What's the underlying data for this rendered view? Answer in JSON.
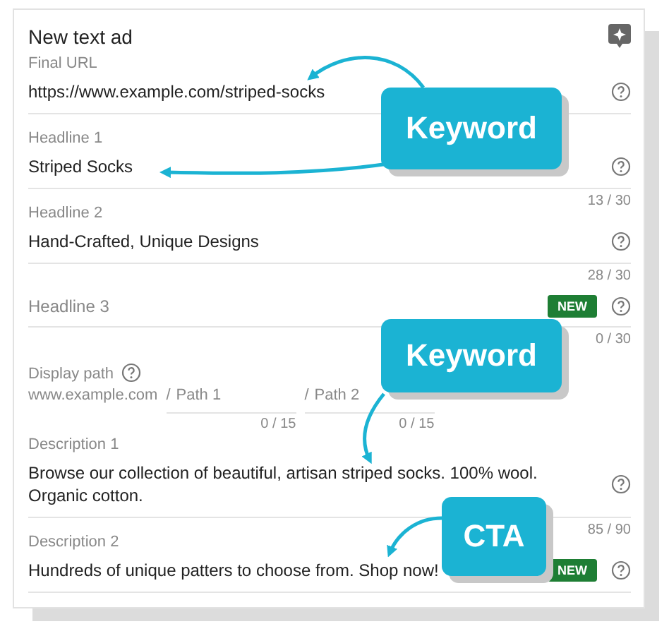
{
  "title": "New text ad",
  "fields": [
    {
      "kind": "text",
      "label": "Final URL",
      "value": "https://www.example.com/striped-socks",
      "help": true
    },
    {
      "kind": "text",
      "label": "Headline 1",
      "value": "Striped Socks",
      "help": true,
      "counter": "13 / 30"
    },
    {
      "kind": "text",
      "label": "Headline 2",
      "value": "Hand-Crafted, Unique Designs",
      "help": true,
      "counter": "28 / 30"
    },
    {
      "kind": "empty",
      "label": "Headline 3",
      "help": true,
      "badge": "NEW",
      "counter": "0 / 30"
    },
    {
      "kind": "path",
      "label": "Display path",
      "help": true,
      "domain": "www.example.com",
      "paths": [
        {
          "prefix": "/",
          "placeholder": "Path 1",
          "counter": "0 / 15"
        },
        {
          "prefix": "/",
          "placeholder": "Path 2",
          "counter": "0 / 15"
        }
      ]
    },
    {
      "kind": "text",
      "label": "Description 1",
      "value": "Browse our collection of beautiful, artisan striped socks. 100% wool. Organic cotton.",
      "help": true,
      "counter": "85 / 90"
    },
    {
      "kind": "text",
      "label": "Description 2",
      "value": "Hundreds of unique patters to choose from. Shop now!",
      "help": true,
      "badge": "NEW"
    }
  ],
  "callouts": [
    {
      "text": "Keyword"
    },
    {
      "text": "Keyword"
    },
    {
      "text": "CTA"
    }
  ]
}
